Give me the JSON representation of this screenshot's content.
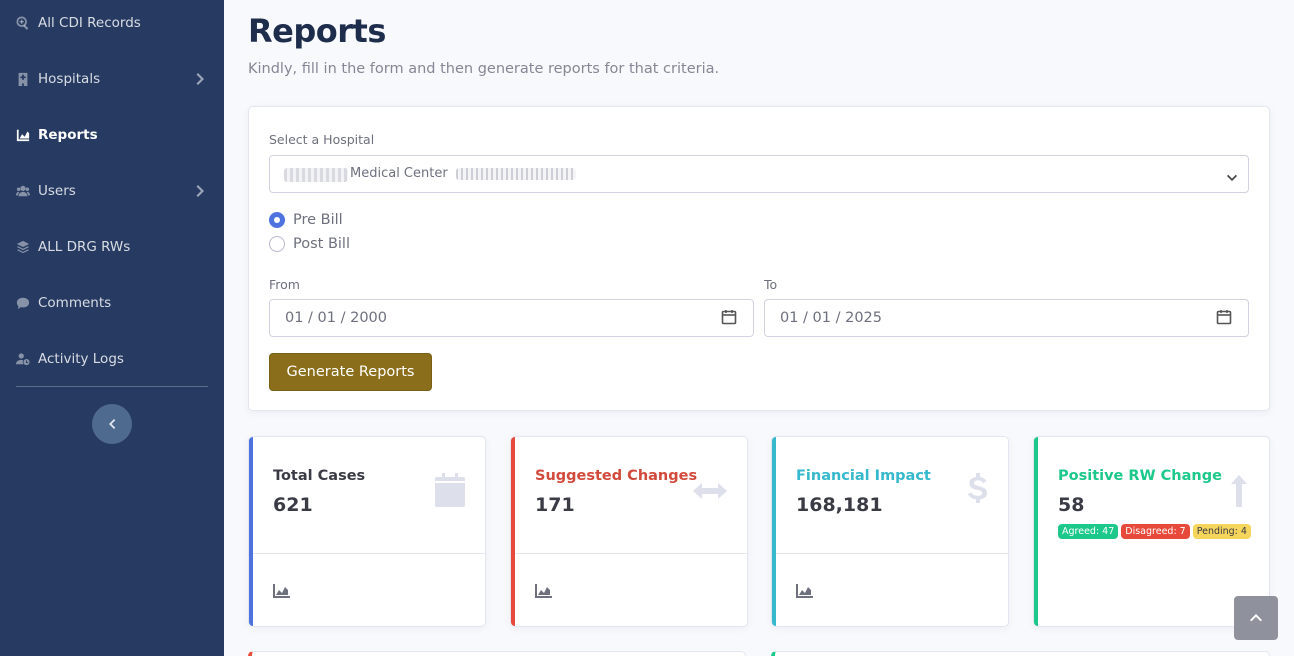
{
  "sidebar": {
    "items": [
      {
        "label": "All CDI Records",
        "icon": "search-plus-icon"
      },
      {
        "label": "Hospitals",
        "icon": "hospital-icon"
      },
      {
        "label": "Reports",
        "icon": "chart-area-icon"
      },
      {
        "label": "Users",
        "icon": "users-icon"
      },
      {
        "label": "ALL DRG RWs",
        "icon": "layers-icon"
      },
      {
        "label": "Comments",
        "icon": "comment-icon"
      },
      {
        "label": "Activity Logs",
        "icon": "user-clock-icon"
      }
    ]
  },
  "header": {
    "title": "Reports",
    "subtitle": "Kindly, fill in the form and then generate reports for that criteria."
  },
  "form": {
    "hospital_label": "Select a Hospital",
    "hospital_value": "Medical Center",
    "radio_pre_bill": "Pre Bill",
    "radio_post_bill": "Post Bill",
    "selected_radio": "Pre Bill",
    "from_label": "From",
    "from_value": "01 / 01 / 2000",
    "to_label": "To",
    "to_value": "01 / 01 / 2025",
    "generate_label": "Generate Reports"
  },
  "stats": {
    "total_cases": {
      "title": "Total Cases",
      "value": "621",
      "color": "#4e73df",
      "icon": "calendar-icon"
    },
    "suggested_changes": {
      "title": "Suggested Changes",
      "value": "171",
      "color": "#e74a3b",
      "icon": "arrows-h-icon"
    },
    "financial_impact": {
      "title": "Financial Impact",
      "value": "168,181",
      "color": "#36b9cc",
      "icon": "dollar-icon"
    },
    "positive_rw": {
      "title": "Positive RW Change",
      "value": "58",
      "color": "#1cc88a",
      "icon": "arrow-up-icon",
      "agreed": "Agreed: 47",
      "disagreed": "Disagreed: 7",
      "pending": "Pending: 4"
    }
  },
  "colors": {
    "sidebar_bg": "#263a62",
    "generate_button": "#8b6e1b",
    "agreed": "#1cc88a",
    "disagreed": "#e74a3b",
    "pending": "#f6c23e"
  }
}
